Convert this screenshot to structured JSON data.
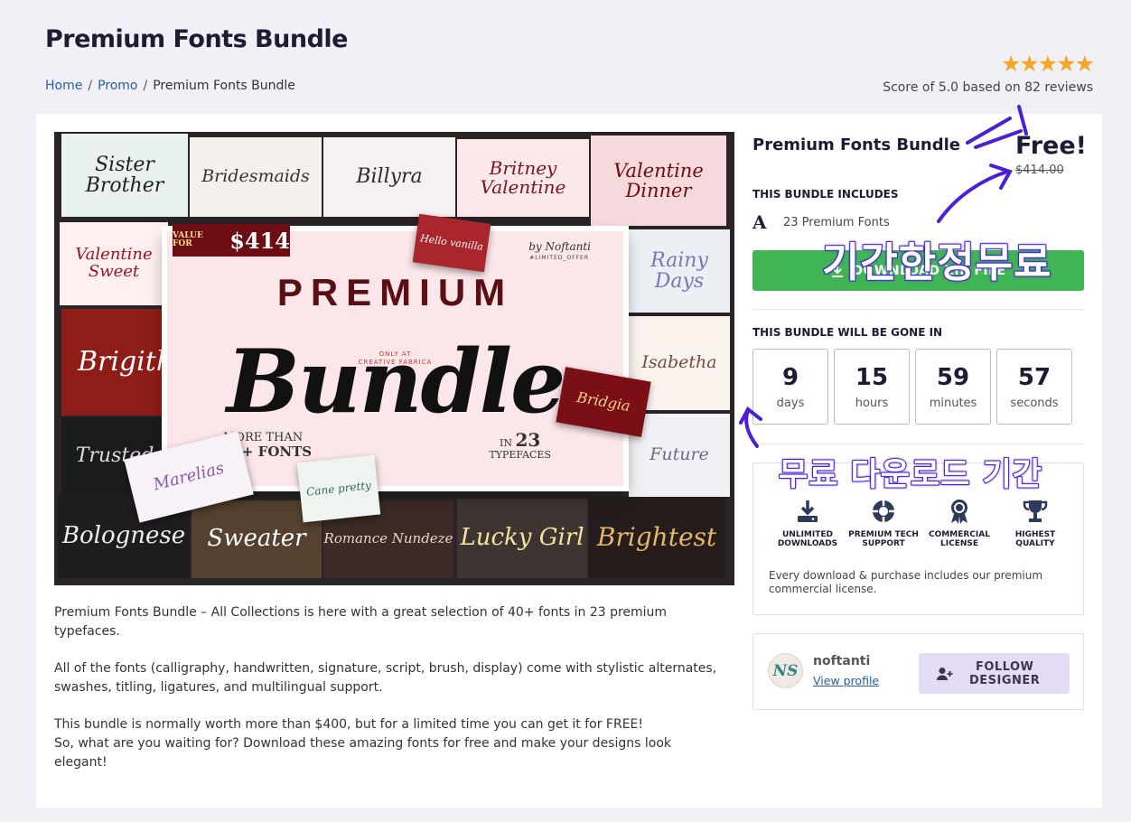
{
  "page": {
    "title": "Premium Fonts Bundle"
  },
  "breadcrumb": {
    "home": "Home",
    "promo": "Promo",
    "current": "Premium Fonts Bundle",
    "separator": "/"
  },
  "rating": {
    "stars": "★★★★★",
    "text": "Score of 5.0 based on 82 reviews",
    "star_color": "#f5a623"
  },
  "hero": {
    "tiles": {
      "sister_brother": "Sister Brother",
      "bridesmaids": "Bridesmaids",
      "billyra": "Billyra",
      "britney_valentine": "Britney Valentine",
      "valentine_dinner": "Valentine Dinner",
      "valentine_sweet": "Valentine Sweet",
      "rainy_days": "Rainy Days",
      "brigitha": "Brigitha",
      "isabetha": "Isabetha",
      "trusted": "Trusted",
      "bridgia": "Bridgia",
      "future": "Future",
      "hello_vanilla": "Hello vanilla",
      "marelias": "Marelias",
      "bologneses": "Bolognese",
      "sweater": "Sweater",
      "romance_nundeze": "Romance Nundeze",
      "lucky_girl": "Lucky Girl",
      "brightest": "Brightest",
      "cane_pretty": "Cane pretty"
    },
    "board": {
      "value_for": "VALUE FOR",
      "value_amount": "$414",
      "by": "by Noftanti",
      "offer": "#LIMITED_OFFER",
      "premium": "PREMIUM",
      "only_at": "ONLY AT",
      "creative_fabrica": "CREATIVE FABRICA",
      "bundle": "Bundle",
      "more_than": "MORE THAN",
      "fonts_count": "40+ FONTS",
      "in": "IN",
      "typeface_count": "23",
      "typefaces": "TYPEFACES"
    }
  },
  "description": {
    "p1": "Premium Fonts Bundle – All Collections is here with a great selection of 40+ fonts in 23 premium typefaces.",
    "p2": "All of the fonts (calligraphy, handwritten, signature, script, brush, display) come with stylistic alternates, swashes, titling, ligatures, and multilingual support.",
    "p3": "This bundle is normally worth more than $400, but for a limited time you can get it for FREE!",
    "p4": "So, what are you waiting for? Download these amazing fonts for free and make your designs look elegant!"
  },
  "sidebar": {
    "title": "Premium Fonts Bundle",
    "price_free": "Free!",
    "price_old": "$414.00",
    "includes_heading": "THIS BUNDLE INCLUDES",
    "includes_icon": "A",
    "includes_item": "23 Premium Fonts",
    "download_label": "DOWNLOAD ZIP FILE",
    "brand_green": "#3fb553",
    "gone_heading": "THIS BUNDLE WILL BE GONE IN",
    "countdown": {
      "days": "9",
      "days_label": "days",
      "hours": "15",
      "hours_label": "hours",
      "minutes": "59",
      "minutes_label": "minutes",
      "seconds": "57",
      "seconds_label": "seconds"
    },
    "features": {
      "downloads_1": "UNLIMITED",
      "downloads_2": "DOWNLOADS",
      "support_1": "PREMIUM TECH",
      "support_2": "SUPPORT",
      "license_1": "COMMERCIAL",
      "license_2": "LICENSE",
      "quality_1": "HIGHEST",
      "quality_2": "QUALITY",
      "note": "Every download & purchase includes our premium commercial license."
    },
    "designer": {
      "avatar_initials": "NS",
      "name": "noftanti",
      "view_profile": "View profile",
      "follow_1": "FOLLOW",
      "follow_2": "DESIGNER",
      "follow_bg": "#e4dbf5"
    }
  },
  "annotations": {
    "free_limited": "기간한정무료",
    "free_download_period": "무료 다운로드 기간",
    "color": "#4a1fd6"
  }
}
